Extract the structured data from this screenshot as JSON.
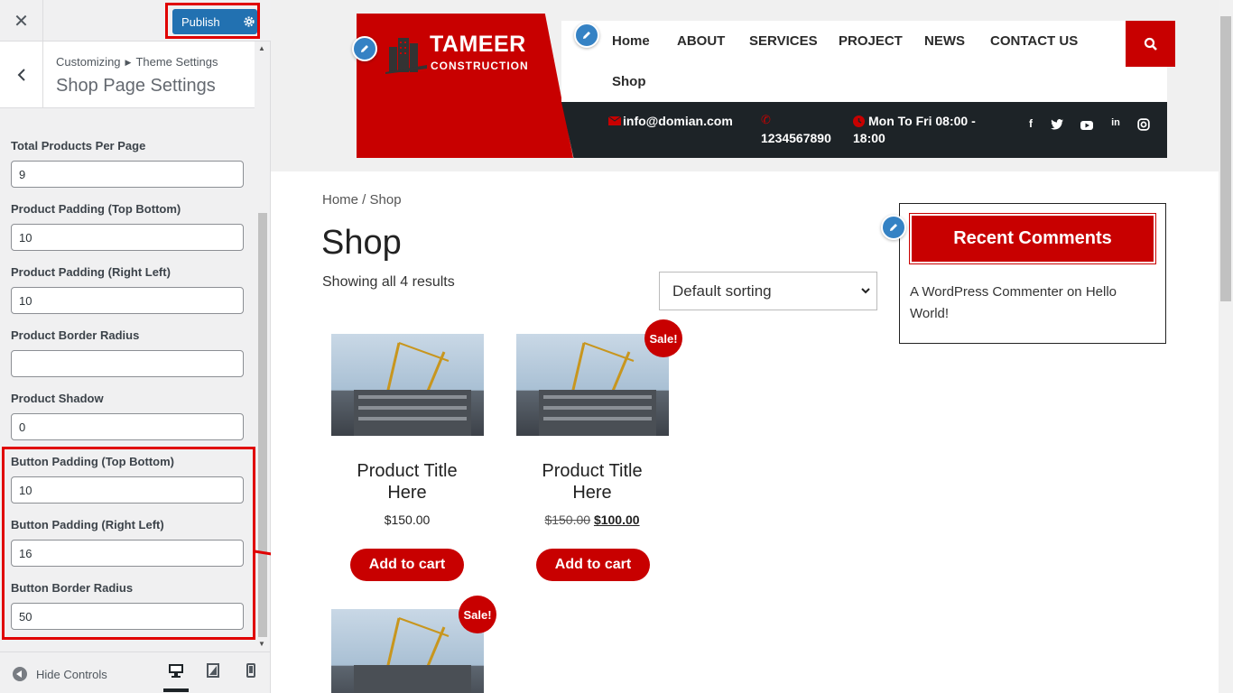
{
  "customizer": {
    "publish_label": "Publish",
    "breadcrumb": [
      "Customizing",
      "Theme Settings"
    ],
    "section_title": "Shop Page Settings",
    "fields": [
      {
        "label": "Total Products Per Page",
        "value": "9"
      },
      {
        "label": "Product Padding (Top Bottom)",
        "value": "10"
      },
      {
        "label": "Product Padding (Right Left)",
        "value": "10"
      },
      {
        "label": "Product Border Radius",
        "value": ""
      },
      {
        "label": "Product Shadow",
        "value": "0"
      },
      {
        "label": "Button Padding (Top Bottom)",
        "value": "10"
      },
      {
        "label": "Button Padding (Right Left)",
        "value": "16"
      },
      {
        "label": "Button Border Radius",
        "value": "50"
      }
    ],
    "hide_controls_label": "Hide Controls"
  },
  "site": {
    "logo_title": "TAMEER",
    "logo_sub": "CONSTRUCTION",
    "nav": [
      "Home",
      "ABOUT",
      "SERVICES",
      "PROJECT",
      "NEWS",
      "CONTACT US",
      "Shop"
    ],
    "email": "info@domian.com",
    "phone": "1234567890",
    "hours_line1": "Mon To Fri 08:00 -",
    "hours_line2": "18:00"
  },
  "shop": {
    "breadcrumb": "Home / Shop",
    "title": "Shop",
    "result_count": "Showing all 4 results",
    "sort_selected": "Default sorting",
    "products": [
      {
        "title_line1": "Product Title",
        "title_line2": "Here",
        "price": "$150.00",
        "old_price": "",
        "sale_price": "",
        "button": "Add to cart"
      },
      {
        "title_line1": "Product Title",
        "title_line2": "Here",
        "price": "",
        "old_price": "$150.00",
        "sale_price": "$100.00",
        "button": "Add to cart",
        "badge": "Sale!"
      },
      {
        "badge": "Sale!"
      }
    ]
  },
  "sidebar_widget": {
    "title": "Recent Comments",
    "commenter": "A WordPress Commenter",
    "on": "on",
    "post": "Hello World!"
  },
  "colors": {
    "accent_red": "#c80000",
    "publish_blue": "#2271b1",
    "highlight_red": "#e00000",
    "topbar_dark": "#1d2327"
  }
}
